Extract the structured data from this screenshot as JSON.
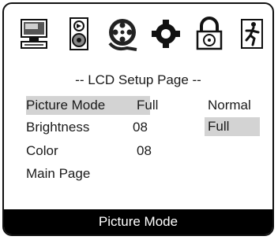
{
  "icons": [
    "monitor-icon",
    "speaker-icon",
    "film-reel-icon",
    "gear-icon",
    "lock-icon",
    "exit-icon"
  ],
  "title": "-- LCD Setup Page --",
  "menu": {
    "items": [
      {
        "label": "Picture Mode",
        "value": "Full"
      },
      {
        "label": "Brightness",
        "value": "08"
      },
      {
        "label": "Color",
        "value": "08"
      },
      {
        "label": "Main Page",
        "value": ""
      }
    ]
  },
  "options": [
    "Normal",
    "Full"
  ],
  "status": "Picture Mode"
}
